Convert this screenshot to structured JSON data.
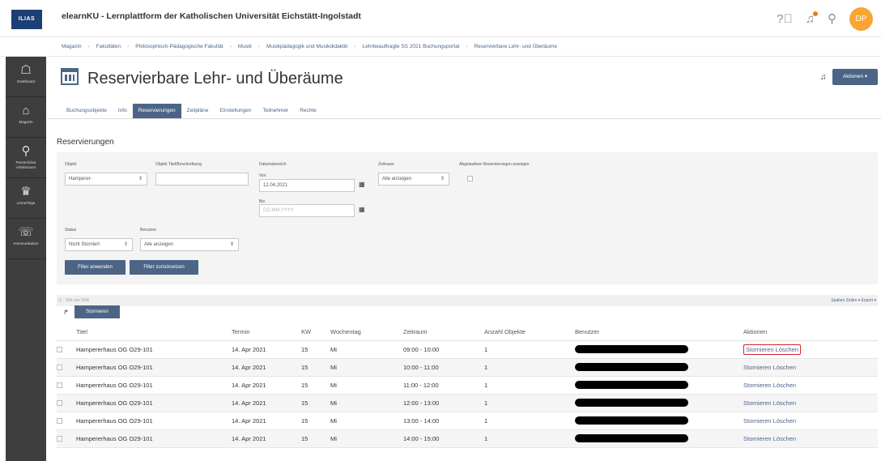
{
  "header": {
    "logo": "ILIAS",
    "title": "elearnKU - Lernplattform der Katholischen Universität Eichstätt-Ingolstadt",
    "avatar_initials": "DP"
  },
  "breadcrumb": [
    "Magazin",
    "Fakultäten",
    "Philosophisch-Pädagogische Fakultät",
    "Musik",
    "Musikpädagogik und Musikdidaktik",
    "Lehrbeauftragte SS 2021 Buchungsportal",
    "Reservierbare Lehr- und Überäume"
  ],
  "sidebar": {
    "items": [
      {
        "label": "Dashboard",
        "glyph": "☖"
      },
      {
        "label": "Magazin",
        "glyph": "⌂"
      },
      {
        "label": "Persönlicher Arbeitsraum",
        "glyph": "⚲"
      },
      {
        "label": "Lernerfolge",
        "glyph": "♛"
      },
      {
        "label": "Kommunikation",
        "glyph": "☏"
      }
    ]
  },
  "page": {
    "title": "Reservierbare Lehr- und Überäume",
    "actions_label": "Aktionen ▾"
  },
  "tabs": [
    {
      "label": "Buchungsobjekte"
    },
    {
      "label": "Info"
    },
    {
      "label": "Reservierungen",
      "active": true
    },
    {
      "label": "Zeitpläne"
    },
    {
      "label": "Einstellungen"
    },
    {
      "label": "Teilnehmer"
    },
    {
      "label": "Rechte"
    }
  ],
  "section_title": "Reservierungen",
  "filter": {
    "objekt_label": "Objekt",
    "objekt_value": "Hamperer-",
    "titel_label": "Objekt Titel/Beschreibung",
    "datum_label": "Datumsbereich",
    "von_label": "Von",
    "von_value": "12.04.2021",
    "bis_label": "Bis",
    "bis_placeholder": "DD.MM.YYYY",
    "zeitraum_label": "Zeitraum",
    "zeitraum_value": "Alle anzeigen",
    "abgelaufen_label": "Abgelaufene Reservierungen anzeigen",
    "status_label": "Status",
    "status_value": "Nicht Storniert",
    "benutzer_label": "Benutzer",
    "benutzer_value": "Alle anzeigen",
    "apply_label": "Filter anwenden",
    "reset_label": "Filter zurücksetzen"
  },
  "list": {
    "count_text": "(1 - 154 von 154)",
    "right_controls": "Spalten  Zeilen ▾  Export ▾",
    "select_indicator": "↱",
    "storno_button": "Stornieren"
  },
  "table": {
    "columns": [
      "Titel",
      "Termin",
      "KW",
      "Wochentag",
      "Zeitraum",
      "Anzahl Objekte",
      "Benutzer",
      "Aktionen"
    ],
    "rows": [
      {
        "titel": "Hampererhaus OG O29-101",
        "termin": "14. Apr 2021",
        "kw": "15",
        "tag": "Mi",
        "zeitraum": "09:00 - 10:00",
        "anzahl": "1",
        "aktionen": "Stornieren Löschen"
      },
      {
        "titel": "Hampererhaus OG O29-101",
        "termin": "14. Apr 2021",
        "kw": "15",
        "tag": "Mi",
        "zeitraum": "10:00 - 11:00",
        "anzahl": "1",
        "aktionen": "Stornieren Löschen"
      },
      {
        "titel": "Hampererhaus OG O29-101",
        "termin": "14. Apr 2021",
        "kw": "15",
        "tag": "Mi",
        "zeitraum": "11:00 - 12:00",
        "anzahl": "1",
        "aktionen": "Stornieren Löschen"
      },
      {
        "titel": "Hampererhaus OG O29-101",
        "termin": "14. Apr 2021",
        "kw": "15",
        "tag": "Mi",
        "zeitraum": "12:00 - 13:00",
        "anzahl": "1",
        "aktionen": "Stornieren Löschen"
      },
      {
        "titel": "Hampererhaus OG O29-101",
        "termin": "14. Apr 2021",
        "kw": "15",
        "tag": "Mi",
        "zeitraum": "13:00 - 14:00",
        "anzahl": "1",
        "aktionen": "Stornieren Löschen"
      },
      {
        "titel": "Hampererhaus OG O29-101",
        "termin": "14. Apr 2021",
        "kw": "15",
        "tag": "Mi",
        "zeitraum": "14:00 - 15:00",
        "anzahl": "1",
        "aktionen": "Stornieren Löschen"
      }
    ]
  }
}
